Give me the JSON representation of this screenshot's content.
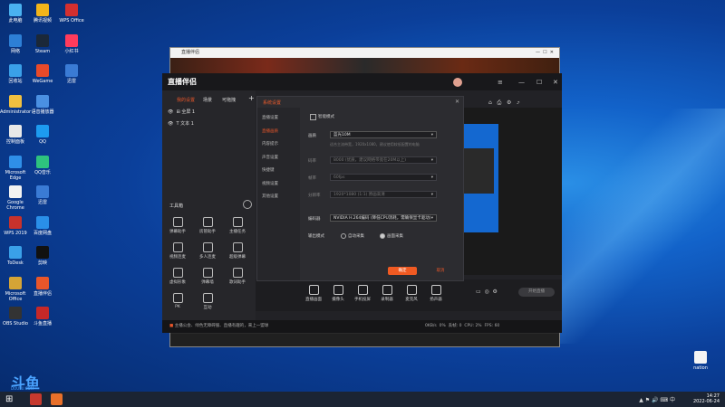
{
  "desktop": {
    "icons_left": [
      "此电脑",
      "网络",
      "回收站",
      "Administrator",
      "控制面板",
      "Microsoft Edge",
      "Google Chrome",
      "WPS 2019",
      "ToDesk",
      "Microsoft Office",
      "OBS Studio"
    ],
    "icons_col2": [
      "腾讯视频",
      "Steam",
      "WeGame",
      "语音播放器",
      "QQ",
      "QQ音乐",
      "迅雷",
      "百度网盘",
      "剪映",
      "直播伴侣",
      "斗鱼直播"
    ],
    "icons_col3": [
      "WPS Office",
      "小红书",
      "迅雷"
    ],
    "right_icon": "nation",
    "watermark": "斗鱼",
    "watermark_sub": "DOUYU.COM"
  },
  "taskbar": {
    "time": "14:27",
    "date": "2022-06-24"
  },
  "back_window": {
    "title": "直播伴侣"
  },
  "app": {
    "logo": "直播伴侣",
    "tabs": [
      "我的设置",
      "场景",
      "可拖拽"
    ],
    "scenes": [
      "全屏 1",
      "文本 1"
    ],
    "toolbox_title": "工具箱",
    "tools": [
      "弹幕助手",
      "房管助手",
      "主播任务",
      "视频连麦",
      "多人连麦",
      "超级弹幕",
      "虚拟形象",
      "弹幕墙",
      "歌词助手",
      "PK",
      "互动"
    ],
    "bottom_items": [
      "直播画面",
      "摄像头",
      "手机投屏",
      "录制器",
      "麦克风",
      "扬声器"
    ],
    "start_button": "开始直播",
    "status": "主播公会、绿色无障碍服、直播有趣的，来上一盟球",
    "status_stats": [
      "0KB/s",
      "0%",
      "丢帧: 0",
      "CPU: 2%",
      "FPS: 60"
    ]
  },
  "dialog": {
    "title": "系统设置",
    "nav": [
      "直播设置",
      "直播画质",
      "内容提示",
      "声音设置",
      "快捷键",
      "视频设置",
      "其他设置"
    ],
    "active_index": 1,
    "smart_mode_label": "智能模式",
    "quality_label": "画质",
    "quality_value": "蓝光10M",
    "quality_hint": "适合主流带宽，1920x1080，建议使用较低配置的电脑",
    "bitrate_label": "码率",
    "bitrate_value": "8000 (优质，建议网络带宽在20M以上)",
    "fps_label": "帧率",
    "fps_value": "60fps",
    "resolution_label": "分辨率",
    "resolution_value": "1920*1080 (1:1) 原画高清",
    "encoder_label": "编码器",
    "encoder_value": "NVIDIA H.264编码 (降低CPU消耗，需确保显卡驱动)",
    "output_mode_label": "输出模式",
    "output_options": [
      "自动采集",
      "画面采集"
    ],
    "ok": "确定",
    "cancel": "取消"
  }
}
